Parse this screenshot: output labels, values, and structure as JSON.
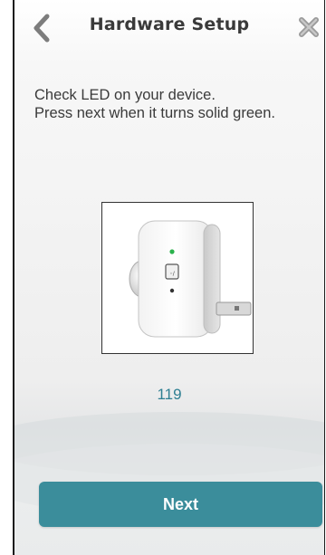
{
  "header": {
    "title": "Hardware Setup",
    "back_icon": "chevron-left-icon",
    "close_icon": "close-icon"
  },
  "instructions": {
    "line1": "Check LED on your device.",
    "line2": "Press next when it turns solid green."
  },
  "device": {
    "image": "range-extender-device-illustration",
    "led_color": "#2bb24c"
  },
  "counter": "119",
  "next_button": {
    "label": "Next",
    "color": "#3b8d9b"
  },
  "colors": {
    "accent": "#3b8d9b",
    "counter_text": "#2e7f92",
    "title_text": "#3a3a3a"
  }
}
